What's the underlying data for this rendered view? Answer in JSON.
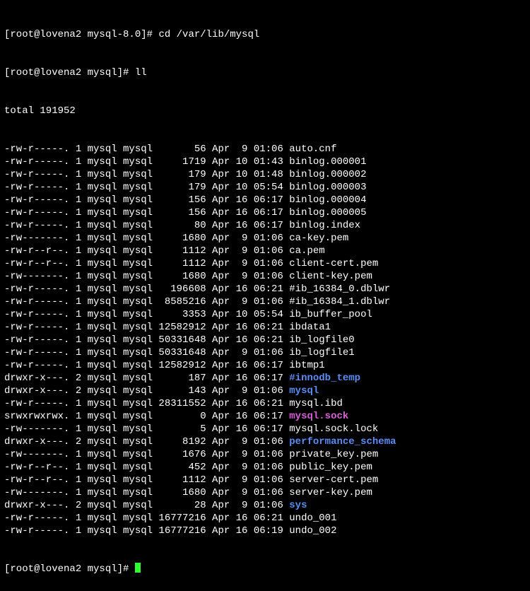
{
  "prompts": {
    "p1": "[root@lovena2 mysql-8.0]# ",
    "p2": "[root@lovena2 mysql]# ",
    "p3": "[root@lovena2 mysql]# "
  },
  "commands": {
    "cd": "cd /var/lib/mysql",
    "ll": "ll"
  },
  "total_line": "total 191952",
  "files": [
    {
      "perm": "-rw-r-----.",
      "links": "1",
      "owner": "mysql",
      "group": "mysql",
      "size": "56",
      "month": "Apr",
      "day": " 9",
      "time": "01:06",
      "name": "auto.cnf",
      "cls": "regular"
    },
    {
      "perm": "-rw-r-----.",
      "links": "1",
      "owner": "mysql",
      "group": "mysql",
      "size": "1719",
      "month": "Apr",
      "day": "10",
      "time": "01:43",
      "name": "binlog.000001",
      "cls": "regular"
    },
    {
      "perm": "-rw-r-----.",
      "links": "1",
      "owner": "mysql",
      "group": "mysql",
      "size": "179",
      "month": "Apr",
      "day": "10",
      "time": "01:48",
      "name": "binlog.000002",
      "cls": "regular"
    },
    {
      "perm": "-rw-r-----.",
      "links": "1",
      "owner": "mysql",
      "group": "mysql",
      "size": "179",
      "month": "Apr",
      "day": "10",
      "time": "05:54",
      "name": "binlog.000003",
      "cls": "regular"
    },
    {
      "perm": "-rw-r-----.",
      "links": "1",
      "owner": "mysql",
      "group": "mysql",
      "size": "156",
      "month": "Apr",
      "day": "16",
      "time": "06:17",
      "name": "binlog.000004",
      "cls": "regular"
    },
    {
      "perm": "-rw-r-----.",
      "links": "1",
      "owner": "mysql",
      "group": "mysql",
      "size": "156",
      "month": "Apr",
      "day": "16",
      "time": "06:17",
      "name": "binlog.000005",
      "cls": "regular"
    },
    {
      "perm": "-rw-r-----.",
      "links": "1",
      "owner": "mysql",
      "group": "mysql",
      "size": "80",
      "month": "Apr",
      "day": "16",
      "time": "06:17",
      "name": "binlog.index",
      "cls": "regular"
    },
    {
      "perm": "-rw-------.",
      "links": "1",
      "owner": "mysql",
      "group": "mysql",
      "size": "1680",
      "month": "Apr",
      "day": " 9",
      "time": "01:06",
      "name": "ca-key.pem",
      "cls": "regular"
    },
    {
      "perm": "-rw-r--r--.",
      "links": "1",
      "owner": "mysql",
      "group": "mysql",
      "size": "1112",
      "month": "Apr",
      "day": " 9",
      "time": "01:06",
      "name": "ca.pem",
      "cls": "regular"
    },
    {
      "perm": "-rw-r--r--.",
      "links": "1",
      "owner": "mysql",
      "group": "mysql",
      "size": "1112",
      "month": "Apr",
      "day": " 9",
      "time": "01:06",
      "name": "client-cert.pem",
      "cls": "regular"
    },
    {
      "perm": "-rw-------.",
      "links": "1",
      "owner": "mysql",
      "group": "mysql",
      "size": "1680",
      "month": "Apr",
      "day": " 9",
      "time": "01:06",
      "name": "client-key.pem",
      "cls": "regular"
    },
    {
      "perm": "-rw-r-----.",
      "links": "1",
      "owner": "mysql",
      "group": "mysql",
      "size": "196608",
      "month": "Apr",
      "day": "16",
      "time": "06:21",
      "name": "#ib_16384_0.dblwr",
      "cls": "regular"
    },
    {
      "perm": "-rw-r-----.",
      "links": "1",
      "owner": "mysql",
      "group": "mysql",
      "size": "8585216",
      "month": "Apr",
      "day": " 9",
      "time": "01:06",
      "name": "#ib_16384_1.dblwr",
      "cls": "regular"
    },
    {
      "perm": "-rw-r-----.",
      "links": "1",
      "owner": "mysql",
      "group": "mysql",
      "size": "3353",
      "month": "Apr",
      "day": "10",
      "time": "05:54",
      "name": "ib_buffer_pool",
      "cls": "regular"
    },
    {
      "perm": "-rw-r-----.",
      "links": "1",
      "owner": "mysql",
      "group": "mysql",
      "size": "12582912",
      "month": "Apr",
      "day": "16",
      "time": "06:21",
      "name": "ibdata1",
      "cls": "regular"
    },
    {
      "perm": "-rw-r-----.",
      "links": "1",
      "owner": "mysql",
      "group": "mysql",
      "size": "50331648",
      "month": "Apr",
      "day": "16",
      "time": "06:21",
      "name": "ib_logfile0",
      "cls": "regular"
    },
    {
      "perm": "-rw-r-----.",
      "links": "1",
      "owner": "mysql",
      "group": "mysql",
      "size": "50331648",
      "month": "Apr",
      "day": " 9",
      "time": "01:06",
      "name": "ib_logfile1",
      "cls": "regular"
    },
    {
      "perm": "-rw-r-----.",
      "links": "1",
      "owner": "mysql",
      "group": "mysql",
      "size": "12582912",
      "month": "Apr",
      "day": "16",
      "time": "06:17",
      "name": "ibtmp1",
      "cls": "regular"
    },
    {
      "perm": "drwxr-x---.",
      "links": "2",
      "owner": "mysql",
      "group": "mysql",
      "size": "187",
      "month": "Apr",
      "day": "16",
      "time": "06:17",
      "name": "#innodb_temp",
      "cls": "dir"
    },
    {
      "perm": "drwxr-x---.",
      "links": "2",
      "owner": "mysql",
      "group": "mysql",
      "size": "143",
      "month": "Apr",
      "day": " 9",
      "time": "01:06",
      "name": "mysql",
      "cls": "dir"
    },
    {
      "perm": "-rw-r-----.",
      "links": "1",
      "owner": "mysql",
      "group": "mysql",
      "size": "28311552",
      "month": "Apr",
      "day": "16",
      "time": "06:21",
      "name": "mysql.ibd",
      "cls": "regular"
    },
    {
      "perm": "srwxrwxrwx.",
      "links": "1",
      "owner": "mysql",
      "group": "mysql",
      "size": "0",
      "month": "Apr",
      "day": "16",
      "time": "06:17",
      "name": "mysql.sock",
      "cls": "sock"
    },
    {
      "perm": "-rw-------.",
      "links": "1",
      "owner": "mysql",
      "group": "mysql",
      "size": "5",
      "month": "Apr",
      "day": "16",
      "time": "06:17",
      "name": "mysql.sock.lock",
      "cls": "regular"
    },
    {
      "perm": "drwxr-x---.",
      "links": "2",
      "owner": "mysql",
      "group": "mysql",
      "size": "8192",
      "month": "Apr",
      "day": " 9",
      "time": "01:06",
      "name": "performance_schema",
      "cls": "dir"
    },
    {
      "perm": "-rw-------.",
      "links": "1",
      "owner": "mysql",
      "group": "mysql",
      "size": "1676",
      "month": "Apr",
      "day": " 9",
      "time": "01:06",
      "name": "private_key.pem",
      "cls": "regular"
    },
    {
      "perm": "-rw-r--r--.",
      "links": "1",
      "owner": "mysql",
      "group": "mysql",
      "size": "452",
      "month": "Apr",
      "day": " 9",
      "time": "01:06",
      "name": "public_key.pem",
      "cls": "regular"
    },
    {
      "perm": "-rw-r--r--.",
      "links": "1",
      "owner": "mysql",
      "group": "mysql",
      "size": "1112",
      "month": "Apr",
      "day": " 9",
      "time": "01:06",
      "name": "server-cert.pem",
      "cls": "regular"
    },
    {
      "perm": "-rw-------.",
      "links": "1",
      "owner": "mysql",
      "group": "mysql",
      "size": "1680",
      "month": "Apr",
      "day": " 9",
      "time": "01:06",
      "name": "server-key.pem",
      "cls": "regular"
    },
    {
      "perm": "drwxr-x---.",
      "links": "2",
      "owner": "mysql",
      "group": "mysql",
      "size": "28",
      "month": "Apr",
      "day": " 9",
      "time": "01:06",
      "name": "sys",
      "cls": "dir"
    },
    {
      "perm": "-rw-r-----.",
      "links": "1",
      "owner": "mysql",
      "group": "mysql",
      "size": "16777216",
      "month": "Apr",
      "day": "16",
      "time": "06:21",
      "name": "undo_001",
      "cls": "regular"
    },
    {
      "perm": "-rw-r-----.",
      "links": "1",
      "owner": "mysql",
      "group": "mysql",
      "size": "16777216",
      "month": "Apr",
      "day": "16",
      "time": "06:19",
      "name": "undo_002",
      "cls": "regular"
    }
  ]
}
